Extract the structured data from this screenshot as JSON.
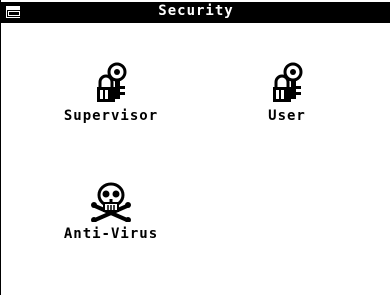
{
  "window": {
    "title": "Security"
  },
  "icons": [
    {
      "label": "Supervisor",
      "icon": "key-lock-icon"
    },
    {
      "label": "User",
      "icon": "key-lock-icon"
    },
    {
      "label": "Anti-Virus",
      "icon": "skull-crossbones-icon"
    }
  ],
  "colors": {
    "titlebar": "#000000",
    "background": "#ffffff",
    "text": "#000000"
  }
}
